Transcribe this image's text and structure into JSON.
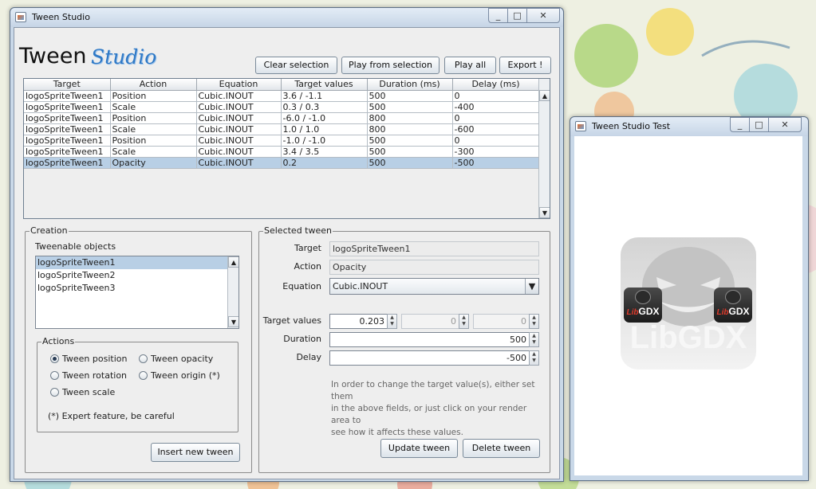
{
  "main_window": {
    "title": "Tween Studio",
    "controls": {
      "minimize": "_",
      "maximize": "□",
      "close": "✕"
    },
    "logo": {
      "word1": "Tween",
      "word2": "Studio"
    },
    "toolbar": {
      "clear_selection": "Clear selection",
      "play_from_selection": "Play from selection",
      "play_all": "Play all",
      "export": "Export !"
    },
    "table": {
      "columns": [
        "Target",
        "Action",
        "Equation",
        "Target values",
        "Duration (ms)",
        "Delay (ms)"
      ],
      "rows": [
        [
          "logoSpriteTween1",
          "Position",
          "Cubic.INOUT",
          "3.6 / -1.1",
          "500",
          "0"
        ],
        [
          "logoSpriteTween1",
          "Scale",
          "Cubic.INOUT",
          "0.3 / 0.3",
          "500",
          "-400"
        ],
        [
          "logoSpriteTween1",
          "Position",
          "Cubic.INOUT",
          "-6.0 / -1.0",
          "800",
          "0"
        ],
        [
          "logoSpriteTween1",
          "Scale",
          "Cubic.INOUT",
          "1.0 / 1.0",
          "800",
          "-600"
        ],
        [
          "logoSpriteTween1",
          "Position",
          "Cubic.INOUT",
          "-1.0 / -1.0",
          "500",
          "0"
        ],
        [
          "logoSpriteTween1",
          "Scale",
          "Cubic.INOUT",
          "3.4 / 3.5",
          "500",
          "-300"
        ],
        [
          "logoSpriteTween1",
          "Opacity",
          "Cubic.INOUT",
          "0.2",
          "500",
          "-500"
        ]
      ],
      "selected_row": 6
    },
    "creation": {
      "title": "Creation",
      "objects_label": "Tweenable objects",
      "objects": [
        "logoSpriteTween1",
        "logoSpriteTween2",
        "logoSpriteTween3"
      ],
      "selected_object": 0,
      "actions": {
        "title": "Actions",
        "position": "Tween position",
        "opacity": "Tween opacity",
        "rotation": "Tween rotation",
        "origin": "Tween origin (*)",
        "scale": "Tween scale",
        "selected": "position",
        "note": "(*) Expert feature, be careful"
      },
      "insert_button": "Insert new tween"
    },
    "selected_tween": {
      "title": "Selected tween",
      "target_label": "Target",
      "target_value": "logoSpriteTween1",
      "action_label": "Action",
      "action_value": "Opacity",
      "equation_label": "Equation",
      "equation_value": "Cubic.INOUT",
      "target_values_label": "Target values",
      "target_values": [
        "0.203",
        "0",
        "0"
      ],
      "duration_label": "Duration",
      "duration_value": "500",
      "delay_label": "Delay",
      "delay_value": "-500",
      "help_lines": [
        "In order to change the target value(s), either set them",
        "in the above fields, or just click on your render area to",
        "see how it affects these values."
      ],
      "update_button": "Update tween",
      "delete_button": "Delete tween"
    }
  },
  "test_window": {
    "title": "Tween Studio Test",
    "logo_small": {
      "lib": "Lib",
      "gdx": "GDX"
    },
    "logo_large": {
      "text": "LibGDX"
    }
  },
  "colors": {
    "selection": "#b8cfe5",
    "title_bar": "#c9d8e8",
    "logo_blue": "#2f79c6",
    "libgdx_red": "#e03a2a"
  }
}
